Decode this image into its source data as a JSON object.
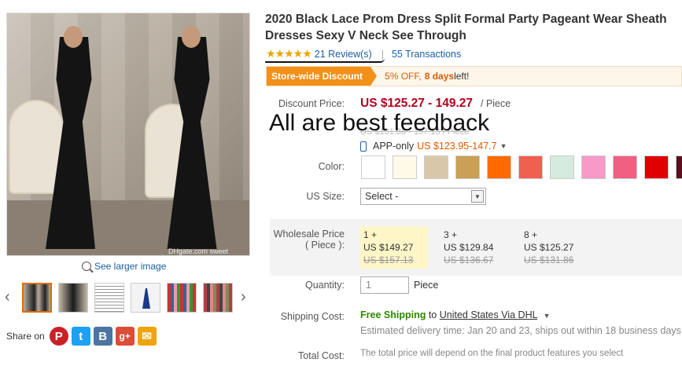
{
  "product": {
    "title": "2020 Black Lace Prom Dress Split Formal Party Pageant Wear Sheath Dresses Sexy V Neck See Through",
    "stars": "★★★★★",
    "reviews_label": "21 Review(s)",
    "separator": "|",
    "transactions_label": "55 Transactions"
  },
  "gallery": {
    "watermark": "DHgate.com sweet",
    "see_larger": "See larger image",
    "prev": "‹",
    "next": "›"
  },
  "share": {
    "label": "Share on",
    "pinterest": "P",
    "twitter": "t",
    "vk": "B",
    "googleplus": "g+",
    "mail": "✉"
  },
  "discount": {
    "tag": "Store-wide Discount",
    "pct": "5% OFF,",
    "days": "8 days",
    "left": " left!"
  },
  "price": {
    "label": "Discount Price:",
    "range": "US $125.27 - 149.27",
    "unit": "/ Piece",
    "faint": "US $131.86 - 157.13 / Piece",
    "app_only": "APP-only",
    "app_price": "US $123.95-147.7",
    "caret": "▼"
  },
  "overlay": {
    "text": "All are best feedback"
  },
  "color": {
    "label": "Color:",
    "swatches": [
      "#ffffff",
      "#fffbe8",
      "#d8c8a8",
      "#c9a055",
      "#ff6a00",
      "#f0604e",
      "#d6ebe0",
      "#f79ac8",
      "#f06080",
      "#e00000",
      "#5a1020"
    ]
  },
  "size": {
    "label": "US Size:",
    "selected": "Select -",
    "caret": "▼"
  },
  "wholesale": {
    "label": "Wholesale Price ( Piece ):",
    "tiers": [
      {
        "qty": "1 +",
        "price": "US $149.27",
        "old": "US $157.13"
      },
      {
        "qty": "3 +",
        "price": "US $129.84",
        "old": "US $136.67"
      },
      {
        "qty": "8 +",
        "price": "US $125.27",
        "old": "US $131.86"
      }
    ]
  },
  "quantity": {
    "label": "Quantity:",
    "value": "1",
    "unit": "Piece"
  },
  "shipping": {
    "label": "Shipping Cost:",
    "free": "Free Shipping",
    "to": " to ",
    "via": "United States Via DHL",
    "caret": "▼",
    "estimate": "Estimated delivery time: Jan 20 and 23, ships out within 18 business days"
  },
  "total": {
    "label": "Total Cost:",
    "note": "The total price will depend on the final product features you select"
  }
}
